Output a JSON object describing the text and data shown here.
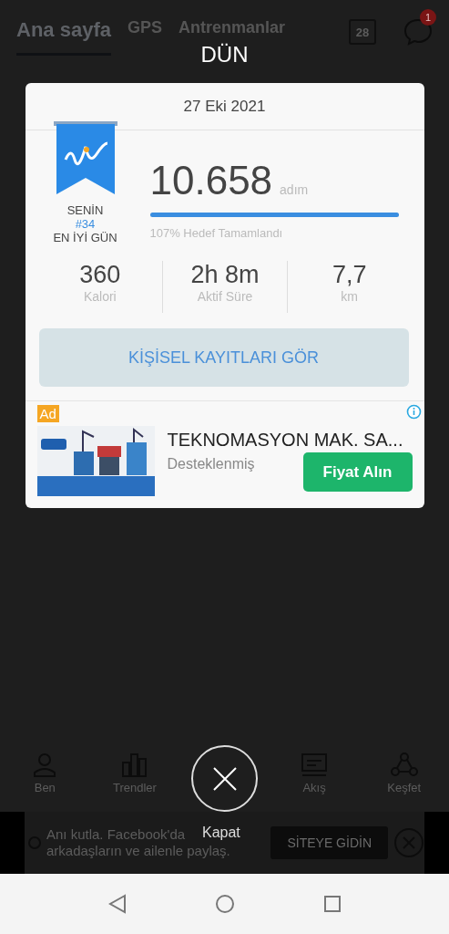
{
  "tabs": [
    {
      "label": "Ana sayfa",
      "selected": true
    },
    {
      "label": "GPS",
      "selected": false
    },
    {
      "label": "Antrenmanlar",
      "selected": false
    }
  ],
  "calendar_day": "28",
  "message_badge": "1",
  "dialog": {
    "title": "DÜN",
    "date": "27 Eki 2021",
    "rank": {
      "top": "SENİN",
      "number": "#34",
      "bottom": "EN İYİ GÜN"
    },
    "steps": "10.658",
    "steps_unit": "adım",
    "goal": {
      "level": 1,
      "text": "107% Hedef Tamamlandı"
    },
    "stats": [
      {
        "value": "360",
        "label": "Kalori"
      },
      {
        "value": "2h 8m",
        "label": "Aktif Süre"
      },
      {
        "value": "7,7",
        "label": "km"
      }
    ],
    "records_button": "KİŞİSEL KAYITLARI GÖR",
    "ad": {
      "badge": "Ad",
      "title": "TEKNOMASYON MAK. SA...",
      "subtitle": "Desteklenmiş",
      "button": "Fiyat Alın"
    }
  },
  "close_label": "Kapat",
  "bottom_nav": [
    {
      "label": "Ben",
      "kind": "person"
    },
    {
      "label": "Trendler",
      "kind": "bars"
    },
    {
      "label": "Akış",
      "kind": "feed"
    },
    {
      "label": "Keşfet",
      "kind": "network"
    }
  ],
  "banner": {
    "line_1": "Anı kutla. Facebook'da",
    "line_2": "arkadaşların ve ailenle paylaş.",
    "button": "SİTEYE GİDİN"
  }
}
